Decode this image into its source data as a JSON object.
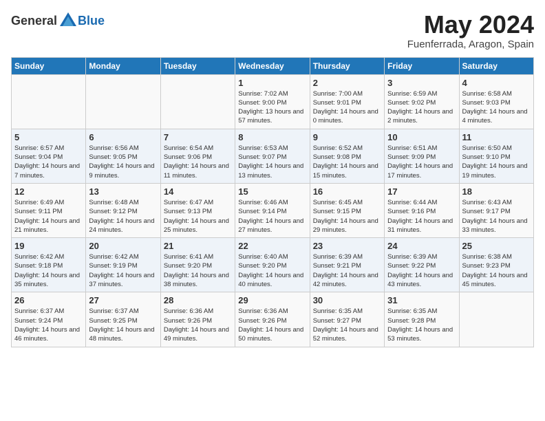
{
  "logo": {
    "general": "General",
    "blue": "Blue"
  },
  "title": "May 2024",
  "subtitle": "Fuenferrada, Aragon, Spain",
  "days_of_week": [
    "Sunday",
    "Monday",
    "Tuesday",
    "Wednesday",
    "Thursday",
    "Friday",
    "Saturday"
  ],
  "weeks": [
    [
      {
        "day": "",
        "info": ""
      },
      {
        "day": "",
        "info": ""
      },
      {
        "day": "",
        "info": ""
      },
      {
        "day": "1",
        "info": "Sunrise: 7:02 AM\nSunset: 9:00 PM\nDaylight: 13 hours and 57 minutes."
      },
      {
        "day": "2",
        "info": "Sunrise: 7:00 AM\nSunset: 9:01 PM\nDaylight: 14 hours and 0 minutes."
      },
      {
        "day": "3",
        "info": "Sunrise: 6:59 AM\nSunset: 9:02 PM\nDaylight: 14 hours and 2 minutes."
      },
      {
        "day": "4",
        "info": "Sunrise: 6:58 AM\nSunset: 9:03 PM\nDaylight: 14 hours and 4 minutes."
      }
    ],
    [
      {
        "day": "5",
        "info": "Sunrise: 6:57 AM\nSunset: 9:04 PM\nDaylight: 14 hours and 7 minutes."
      },
      {
        "day": "6",
        "info": "Sunrise: 6:56 AM\nSunset: 9:05 PM\nDaylight: 14 hours and 9 minutes."
      },
      {
        "day": "7",
        "info": "Sunrise: 6:54 AM\nSunset: 9:06 PM\nDaylight: 14 hours and 11 minutes."
      },
      {
        "day": "8",
        "info": "Sunrise: 6:53 AM\nSunset: 9:07 PM\nDaylight: 14 hours and 13 minutes."
      },
      {
        "day": "9",
        "info": "Sunrise: 6:52 AM\nSunset: 9:08 PM\nDaylight: 14 hours and 15 minutes."
      },
      {
        "day": "10",
        "info": "Sunrise: 6:51 AM\nSunset: 9:09 PM\nDaylight: 14 hours and 17 minutes."
      },
      {
        "day": "11",
        "info": "Sunrise: 6:50 AM\nSunset: 9:10 PM\nDaylight: 14 hours and 19 minutes."
      }
    ],
    [
      {
        "day": "12",
        "info": "Sunrise: 6:49 AM\nSunset: 9:11 PM\nDaylight: 14 hours and 21 minutes."
      },
      {
        "day": "13",
        "info": "Sunrise: 6:48 AM\nSunset: 9:12 PM\nDaylight: 14 hours and 24 minutes."
      },
      {
        "day": "14",
        "info": "Sunrise: 6:47 AM\nSunset: 9:13 PM\nDaylight: 14 hours and 25 minutes."
      },
      {
        "day": "15",
        "info": "Sunrise: 6:46 AM\nSunset: 9:14 PM\nDaylight: 14 hours and 27 minutes."
      },
      {
        "day": "16",
        "info": "Sunrise: 6:45 AM\nSunset: 9:15 PM\nDaylight: 14 hours and 29 minutes."
      },
      {
        "day": "17",
        "info": "Sunrise: 6:44 AM\nSunset: 9:16 PM\nDaylight: 14 hours and 31 minutes."
      },
      {
        "day": "18",
        "info": "Sunrise: 6:43 AM\nSunset: 9:17 PM\nDaylight: 14 hours and 33 minutes."
      }
    ],
    [
      {
        "day": "19",
        "info": "Sunrise: 6:42 AM\nSunset: 9:18 PM\nDaylight: 14 hours and 35 minutes."
      },
      {
        "day": "20",
        "info": "Sunrise: 6:42 AM\nSunset: 9:19 PM\nDaylight: 14 hours and 37 minutes."
      },
      {
        "day": "21",
        "info": "Sunrise: 6:41 AM\nSunset: 9:20 PM\nDaylight: 14 hours and 38 minutes."
      },
      {
        "day": "22",
        "info": "Sunrise: 6:40 AM\nSunset: 9:20 PM\nDaylight: 14 hours and 40 minutes."
      },
      {
        "day": "23",
        "info": "Sunrise: 6:39 AM\nSunset: 9:21 PM\nDaylight: 14 hours and 42 minutes."
      },
      {
        "day": "24",
        "info": "Sunrise: 6:39 AM\nSunset: 9:22 PM\nDaylight: 14 hours and 43 minutes."
      },
      {
        "day": "25",
        "info": "Sunrise: 6:38 AM\nSunset: 9:23 PM\nDaylight: 14 hours and 45 minutes."
      }
    ],
    [
      {
        "day": "26",
        "info": "Sunrise: 6:37 AM\nSunset: 9:24 PM\nDaylight: 14 hours and 46 minutes."
      },
      {
        "day": "27",
        "info": "Sunrise: 6:37 AM\nSunset: 9:25 PM\nDaylight: 14 hours and 48 minutes."
      },
      {
        "day": "28",
        "info": "Sunrise: 6:36 AM\nSunset: 9:26 PM\nDaylight: 14 hours and 49 minutes."
      },
      {
        "day": "29",
        "info": "Sunrise: 6:36 AM\nSunset: 9:26 PM\nDaylight: 14 hours and 50 minutes."
      },
      {
        "day": "30",
        "info": "Sunrise: 6:35 AM\nSunset: 9:27 PM\nDaylight: 14 hours and 52 minutes."
      },
      {
        "day": "31",
        "info": "Sunrise: 6:35 AM\nSunset: 9:28 PM\nDaylight: 14 hours and 53 minutes."
      },
      {
        "day": "",
        "info": ""
      }
    ]
  ]
}
